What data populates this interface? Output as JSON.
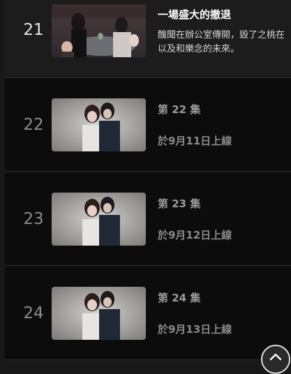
{
  "episodes": [
    {
      "number": "21",
      "title": "一場盛大的撤退",
      "description_line1": "醜聞在辦公室傳開，毀了之桃在",
      "description_line2": "以及和樂念的未來。",
      "state": "current"
    },
    {
      "number": "22",
      "title": "第 22 集",
      "release": "於9月11日上線",
      "state": "upcoming"
    },
    {
      "number": "23",
      "title": "第 23 集",
      "release": "於9月12日上線",
      "state": "upcoming"
    },
    {
      "number": "24",
      "title": "第 24 集",
      "release": "於9月13日上線",
      "state": "upcoming"
    }
  ],
  "scroll_top": {
    "icon": "chevron-up-icon"
  },
  "colors": {
    "background": "#181818",
    "row_background": "#0c0c0c",
    "current_row": "#1c1c1c",
    "muted_text": "#8a8a8a"
  }
}
